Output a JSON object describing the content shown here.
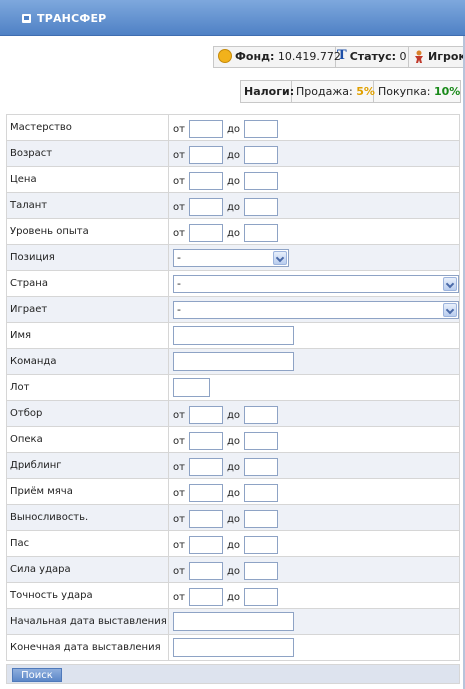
{
  "header": {
    "title": "ТРАНСФЕР"
  },
  "stats": {
    "fund_label": "Фонд:",
    "fund_value": "10.419.772",
    "status_label": "Статус:",
    "status_value": "0",
    "player_label": "Игрок"
  },
  "taxes": {
    "label": "Налоги:",
    "sale_label": "Продажа:",
    "sale_value": "5%",
    "purchase_label": "Покупка:",
    "purchase_value": "10%",
    "sale_color": "#e0a000",
    "purchase_color": "#1a8a1a"
  },
  "range_words": {
    "from": "от",
    "to": "до"
  },
  "fields": {
    "mastery": "Мастерство",
    "age": "Возраст",
    "price": "Цена",
    "talent": "Талант",
    "exp_level": "Уровень опыта",
    "position": "Позиция",
    "country": "Страна",
    "plays": "Играет",
    "name": "Имя",
    "team": "Команда",
    "lot": "Лот",
    "tackling": "Отбор",
    "marking": "Опека",
    "dribbling": "Дриблинг",
    "ball_control": "Приём мяча",
    "stamina": "Выносливость.",
    "passing": "Пас",
    "shot_power": "Сила удара",
    "shot_accuracy": "Точность удара",
    "start_date": "Начальная дата выставления",
    "end_date": "Конечная дата выставления"
  },
  "selects": {
    "position": "-",
    "country": "-",
    "plays": "-"
  },
  "footer": {
    "search_label": "Поиск"
  }
}
